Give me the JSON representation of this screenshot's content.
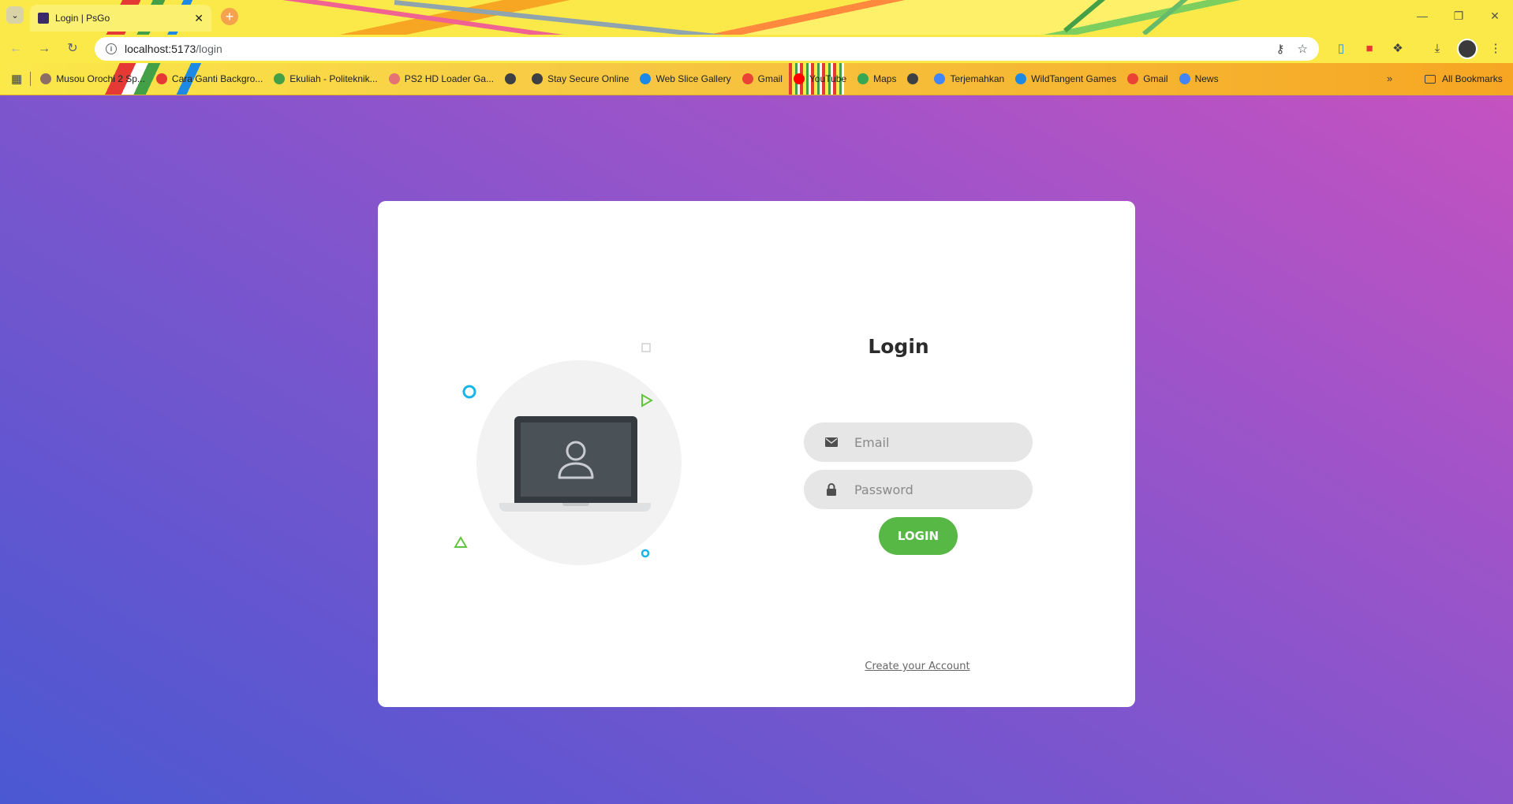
{
  "browser": {
    "tab": {
      "title": "Login | PsGo"
    },
    "address_bar": {
      "host": "localhost:5173",
      "path": "/login"
    },
    "bookmarks": [
      {
        "label": "Musou Orochi 2 Sp...",
        "icon_color": "#8d6e63"
      },
      {
        "label": "Cara Ganti Backgro...",
        "icon_color": "#e53935"
      },
      {
        "label": "Ekuliah - Politeknik...",
        "icon_color": "#43a047"
      },
      {
        "label": "PS2 HD Loader Ga...",
        "icon_color": "#e57373"
      },
      {
        "label": "",
        "icon_color": "#3c4043"
      },
      {
        "label": "Stay Secure Online",
        "icon_color": "#3c4043"
      },
      {
        "label": "Web Slice Gallery",
        "icon_color": "#1e88e5"
      },
      {
        "label": "Gmail",
        "icon_color": "#ea4335"
      },
      {
        "label": "YouTube",
        "icon_color": "#ff0000"
      },
      {
        "label": "Maps",
        "icon_color": "#34a853"
      },
      {
        "label": "",
        "icon_color": "#3c4043"
      },
      {
        "label": "Terjemahkan",
        "icon_color": "#4285f4"
      },
      {
        "label": "WildTangent Games",
        "icon_color": "#1e88e5"
      },
      {
        "label": "Gmail",
        "icon_color": "#ea4335"
      },
      {
        "label": "News",
        "icon_color": "#4285f4"
      }
    ],
    "all_bookmarks_label": "All Bookmarks"
  },
  "login": {
    "title": "Login",
    "email_placeholder": "Email",
    "password_placeholder": "Password",
    "button_label": "LOGIN",
    "create_account_label": "Create your Account"
  },
  "colors": {
    "button": "#57b846",
    "field_bg": "#e6e6e6",
    "background_start": "#4a58d2",
    "background_end": "#c552c0"
  }
}
